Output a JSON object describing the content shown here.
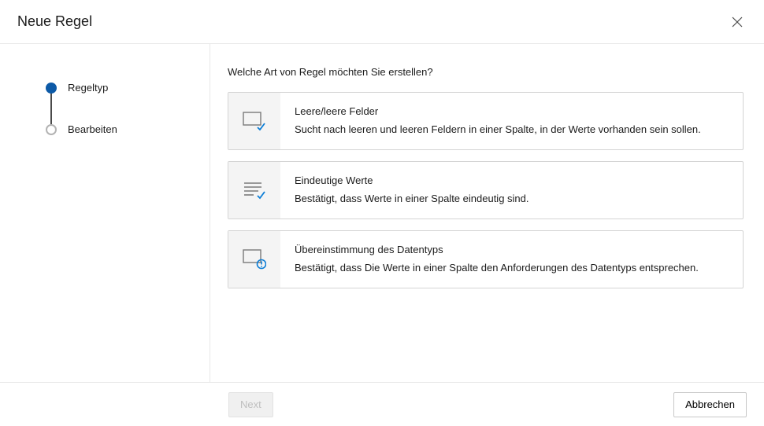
{
  "header": {
    "title": "Neue Regel"
  },
  "sidebar": {
    "steps": [
      {
        "label": "Regeltyp",
        "active": true
      },
      {
        "label": "Bearbeiten",
        "active": false
      }
    ]
  },
  "main": {
    "question": "Welche Art von Regel möchten Sie erstellen?",
    "options": [
      {
        "title": "Leere/leere Felder",
        "desc": "Sucht nach leeren und leeren Feldern in einer Spalte, in der Werte vorhanden sein sollen."
      },
      {
        "title": "Eindeutige Werte",
        "desc": "Bestätigt, dass Werte in einer Spalte eindeutig sind."
      },
      {
        "title": "Übereinstimmung des Datentyps",
        "desc": "Bestätigt, dass Die Werte in einer Spalte den Anforderungen des Datentyps entsprechen."
      }
    ]
  },
  "footer": {
    "next_label": "Next",
    "cancel_label": "Abbrechen"
  }
}
